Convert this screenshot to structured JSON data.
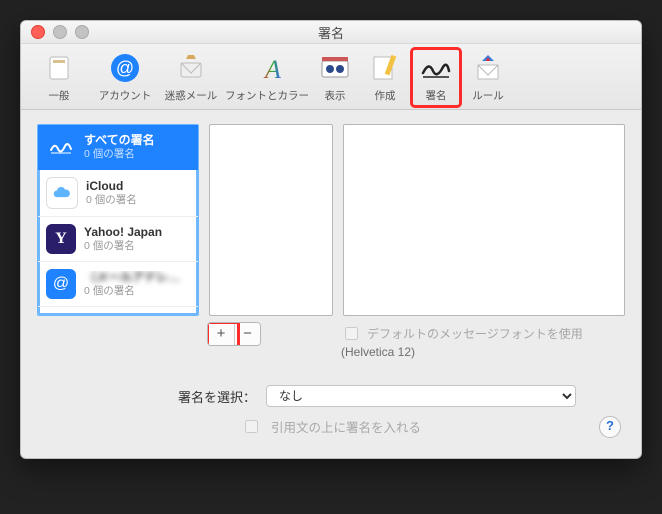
{
  "window": {
    "title": "署名"
  },
  "toolbar": {
    "items": [
      {
        "label": "一般"
      },
      {
        "label": "アカウント"
      },
      {
        "label": "迷惑メール"
      },
      {
        "label": "フォントとカラー"
      },
      {
        "label": "表示"
      },
      {
        "label": "作成"
      },
      {
        "label": "署名"
      },
      {
        "label": "ルール"
      }
    ]
  },
  "accounts": {
    "all": {
      "title": "すべての署名",
      "sub": "0 個の署名"
    },
    "icloud": {
      "title": "iCloud",
      "sub": "0 個の署名"
    },
    "yahoo": {
      "title": "Yahoo! Japan",
      "sub": "0 個の署名",
      "icon_letter": "Y"
    },
    "at": {
      "title": "（メールアドレス）",
      "sub": "0 個の署名",
      "icon_glyph": "@"
    }
  },
  "buttons": {
    "add": "+",
    "remove": "−"
  },
  "defaultFont": {
    "checkbox_label": "デフォルトのメッセージフォントを使用",
    "font_line": "(Helvetica 12)"
  },
  "selector": {
    "label": "署名を選択：",
    "value": "なし"
  },
  "aboveQuote": {
    "label": "引用文の上に署名を入れる"
  },
  "help": {
    "glyph": "?"
  },
  "colors": {
    "highlight": "#ff2a2a",
    "selection": "#1f82ff"
  }
}
